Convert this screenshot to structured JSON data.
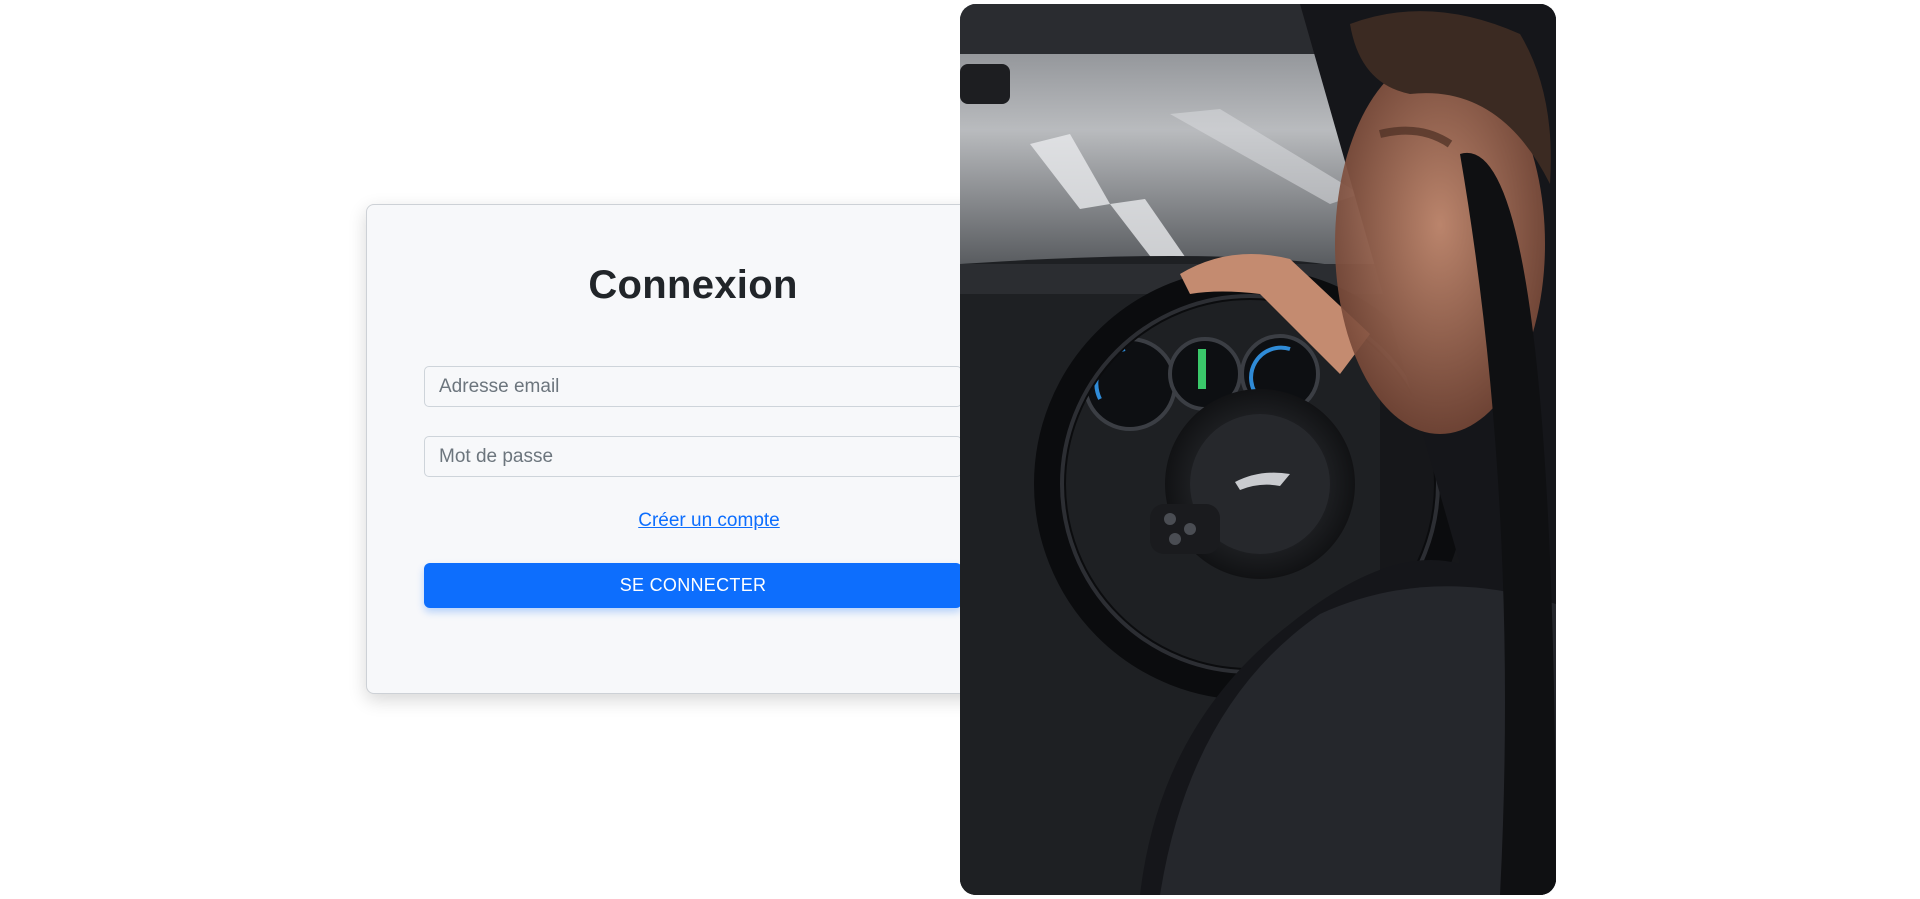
{
  "login": {
    "title": "Connexion",
    "email_placeholder": "Adresse email",
    "email_value": "",
    "password_placeholder": "Mot de passe",
    "password_value": "",
    "create_account_label": "Créer un compte",
    "submit_label": "SE CONNECTER"
  },
  "photo": {
    "subject": "driver at steering wheel"
  },
  "colors": {
    "primary": "#0d6efd",
    "card_background": "#f7f8fa",
    "page_background": "#ffffff",
    "title": "#212529"
  }
}
